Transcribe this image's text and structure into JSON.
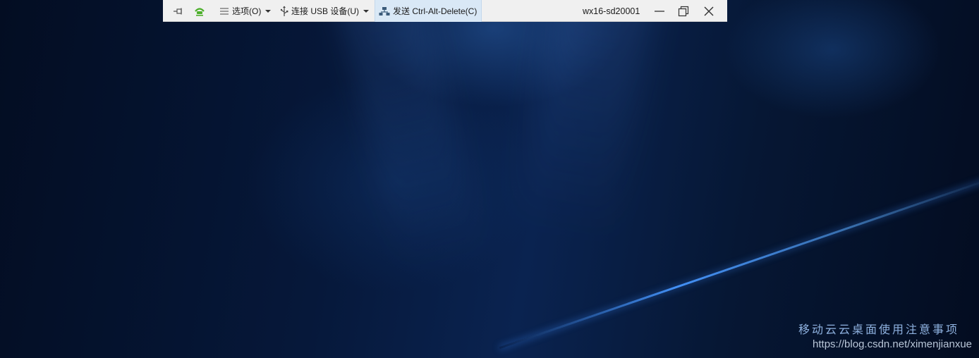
{
  "toolbar": {
    "options_label": "选项(O)",
    "usb_label": "连接 USB 设备(U)",
    "cad_label": "发送 Ctrl-Alt-Delete(C)",
    "window_title": "wx16-sd20001",
    "icons": {
      "pin": "pin-icon",
      "connection": "connection-status-icon",
      "options": "menu-lines-icon",
      "usb": "usb-icon",
      "cad": "network-icon",
      "minimize": "minimize-icon",
      "restore": "restore-icon",
      "close": "close-icon"
    },
    "colors": {
      "background": "#f0f0f0",
      "highlight": "#d9e8f6",
      "connection_green": "#4caf2a"
    }
  },
  "desktop": {
    "watermark_title": "移动云云桌面使用注意事项",
    "watermark_url": "https://blog.csdn.net/ximenjianxue"
  }
}
